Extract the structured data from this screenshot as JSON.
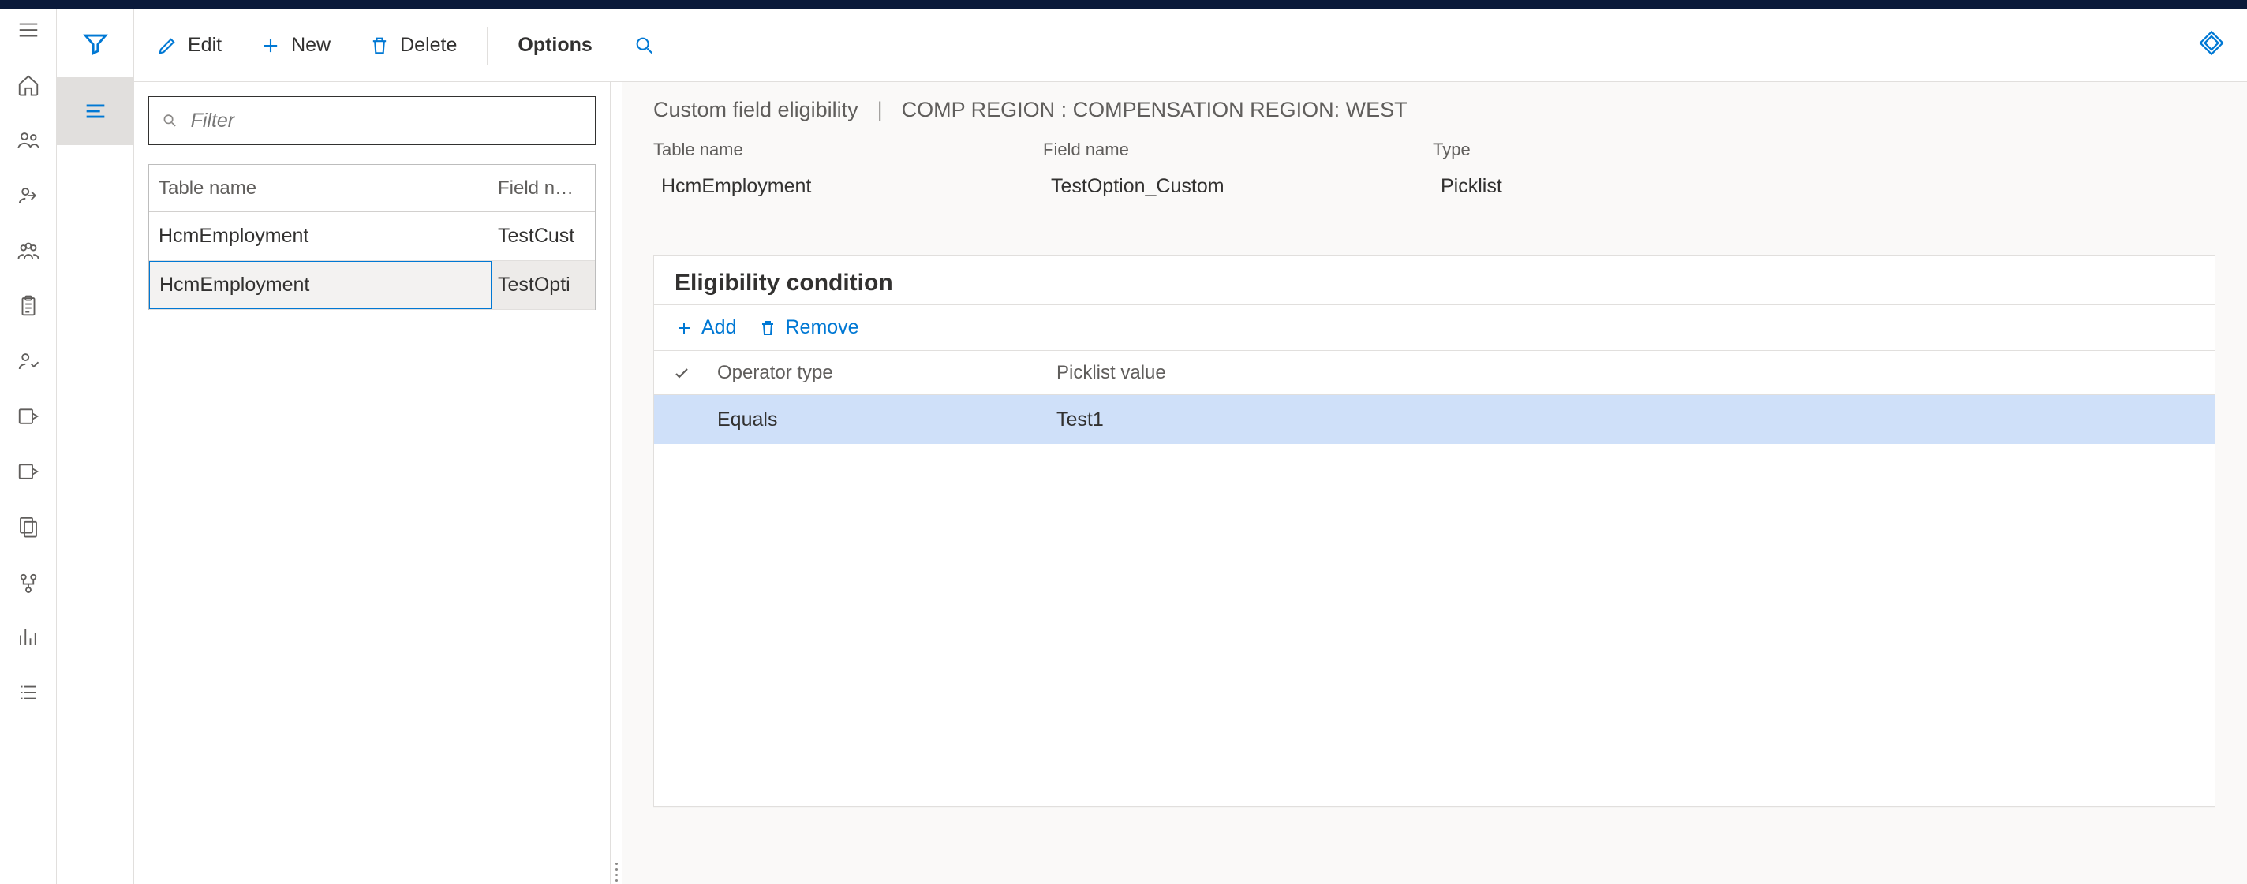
{
  "commandBar": {
    "edit": "Edit",
    "new": "New",
    "delete": "Delete",
    "options": "Options"
  },
  "filter": {
    "placeholder": "Filter"
  },
  "list": {
    "headers": {
      "tableName": "Table name",
      "fieldName": "Field n…"
    },
    "rows": [
      {
        "table": "HcmEmployment",
        "field": "TestCust"
      },
      {
        "table": "HcmEmployment",
        "field": "TestOpti"
      }
    ]
  },
  "breadcrumb": {
    "title": "Custom field eligibility",
    "context": "COMP REGION : COMPENSATION REGION: WEST"
  },
  "form": {
    "tableNameLabel": "Table name",
    "tableName": "HcmEmployment",
    "fieldNameLabel": "Field name",
    "fieldName": "TestOption_Custom",
    "typeLabel": "Type",
    "type": "Picklist"
  },
  "section": {
    "title": "Eligibility condition",
    "add": "Add",
    "remove": "Remove",
    "headers": {
      "operator": "Operator type",
      "picklist": "Picklist value"
    },
    "rows": [
      {
        "operator": "Equals",
        "value": "Test1"
      }
    ]
  }
}
